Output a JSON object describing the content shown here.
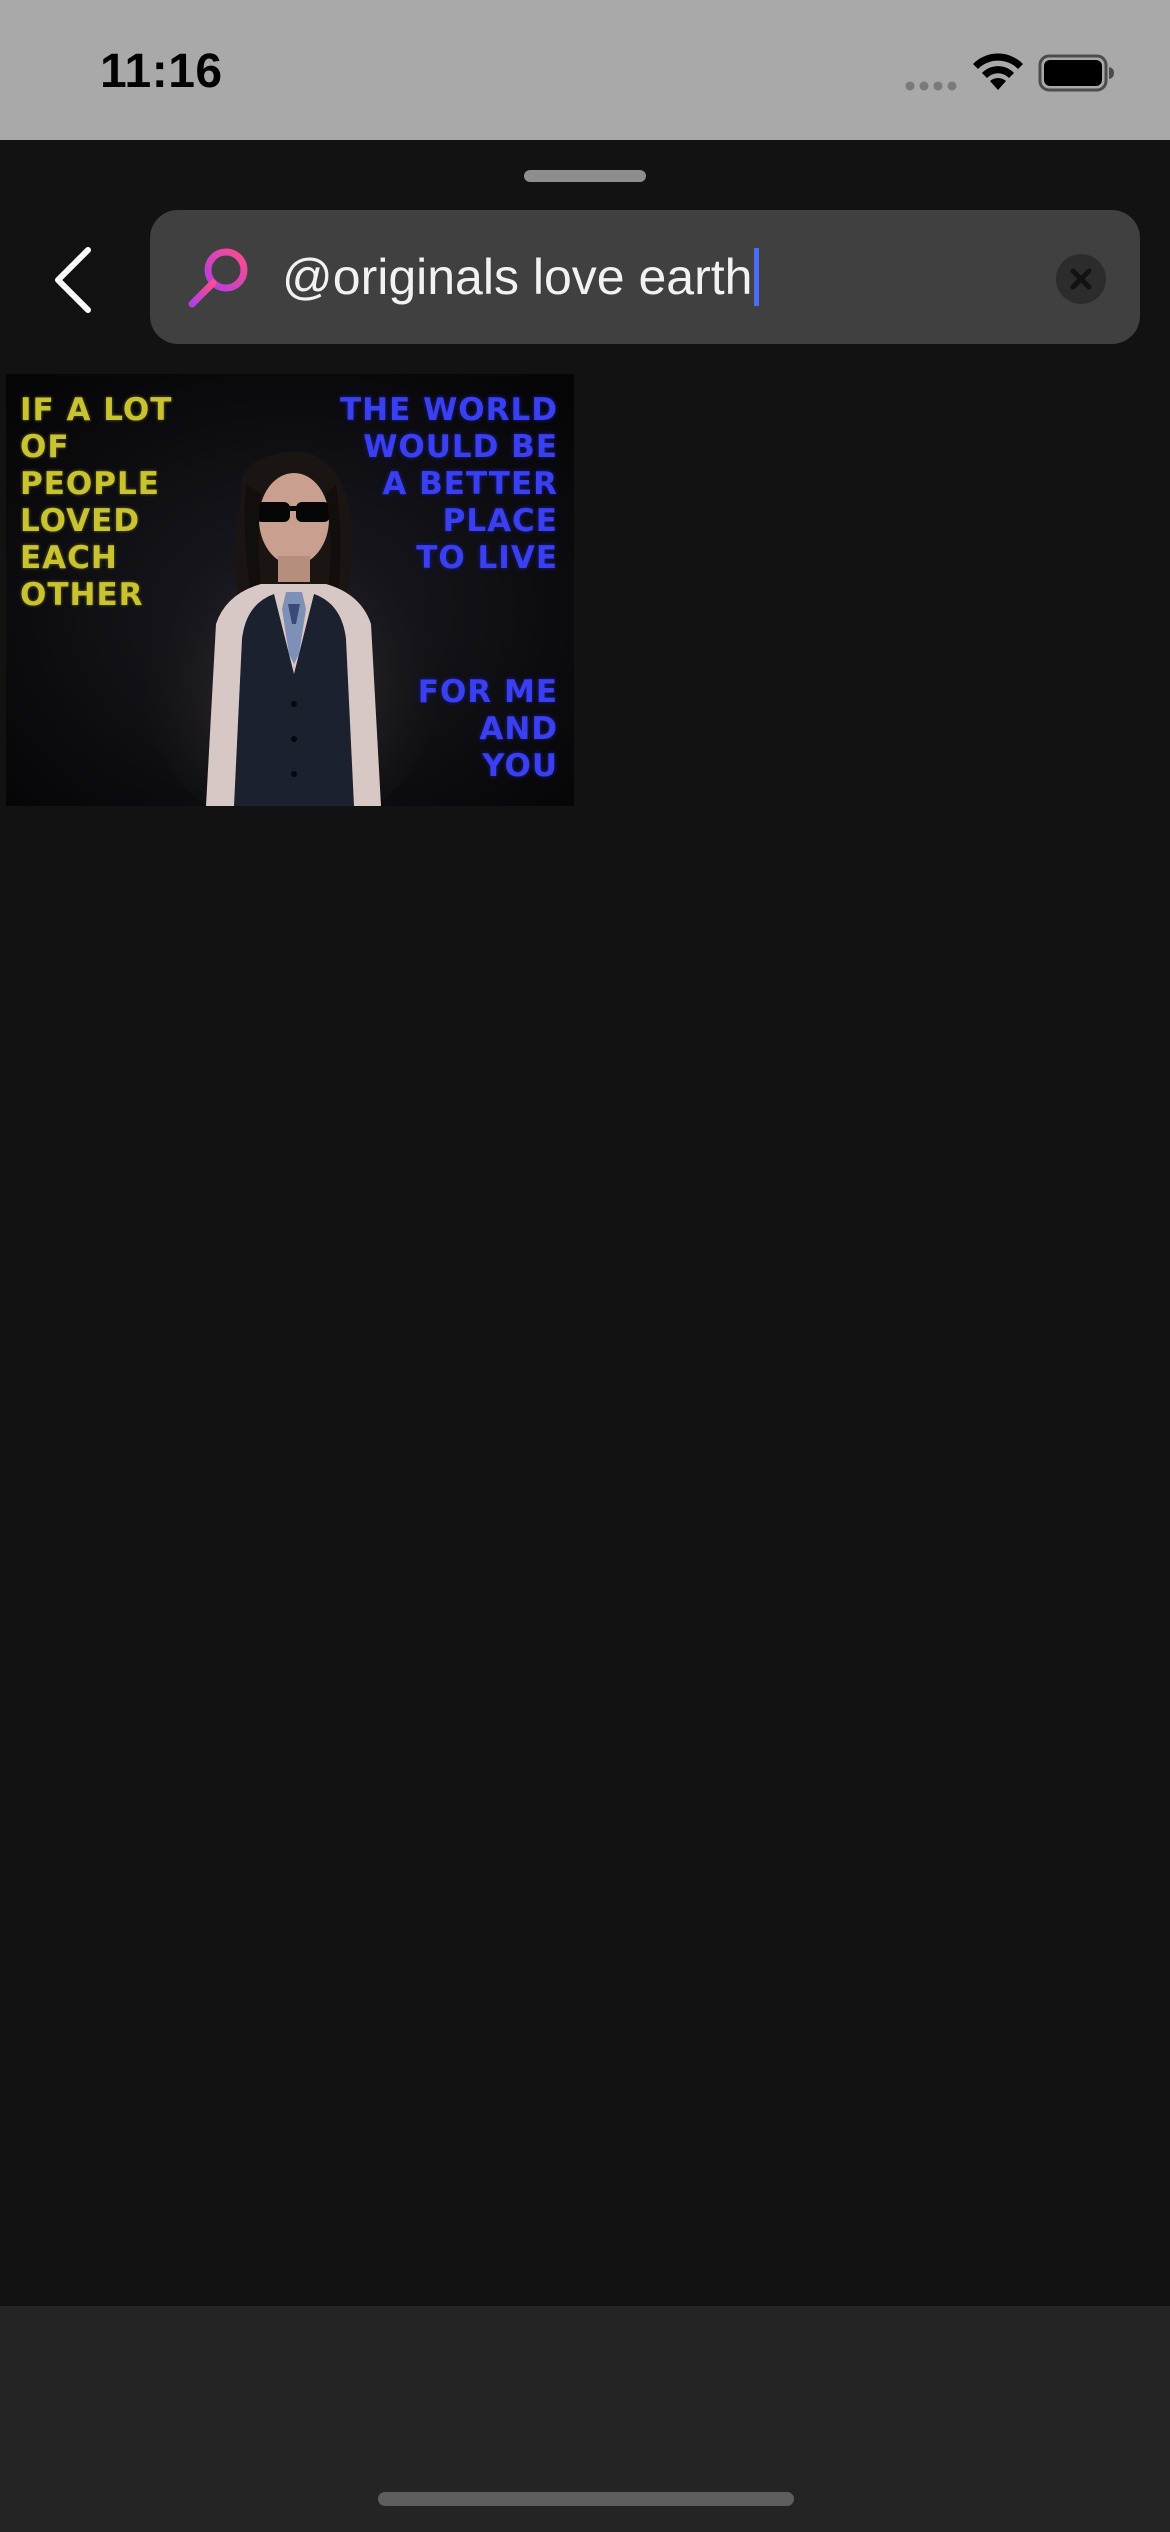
{
  "status_bar": {
    "time": "11:16",
    "signal_icon": "signal-dots-icon",
    "wifi_icon": "wifi-icon",
    "battery_icon": "battery-full-icon"
  },
  "navigation": {
    "back_icon": "chevron-left-icon"
  },
  "search": {
    "icon": "search-icon",
    "query": "@originals love earth",
    "clear_icon": "clear-circle-icon",
    "accent_colors": [
      "#c744d1",
      "#ff4b8d"
    ],
    "caret_color": "#4b6bff"
  },
  "results": [
    {
      "type": "gif",
      "text_left": "IF A LOT\nOF PEOPLE\nLOVED\nEACH\nOTHER",
      "text_right_top": "THE WORLD\nWOULD BE\nA BETTER\nPLACE\nTO LIVE",
      "text_right_bottom": "FOR ME\nAND\nYOU"
    }
  ],
  "colors": {
    "background": "#121212",
    "status_bar_bg": "#a9a9a9",
    "search_bar_bg": "#404040",
    "bottom_bar_bg": "#242424"
  }
}
